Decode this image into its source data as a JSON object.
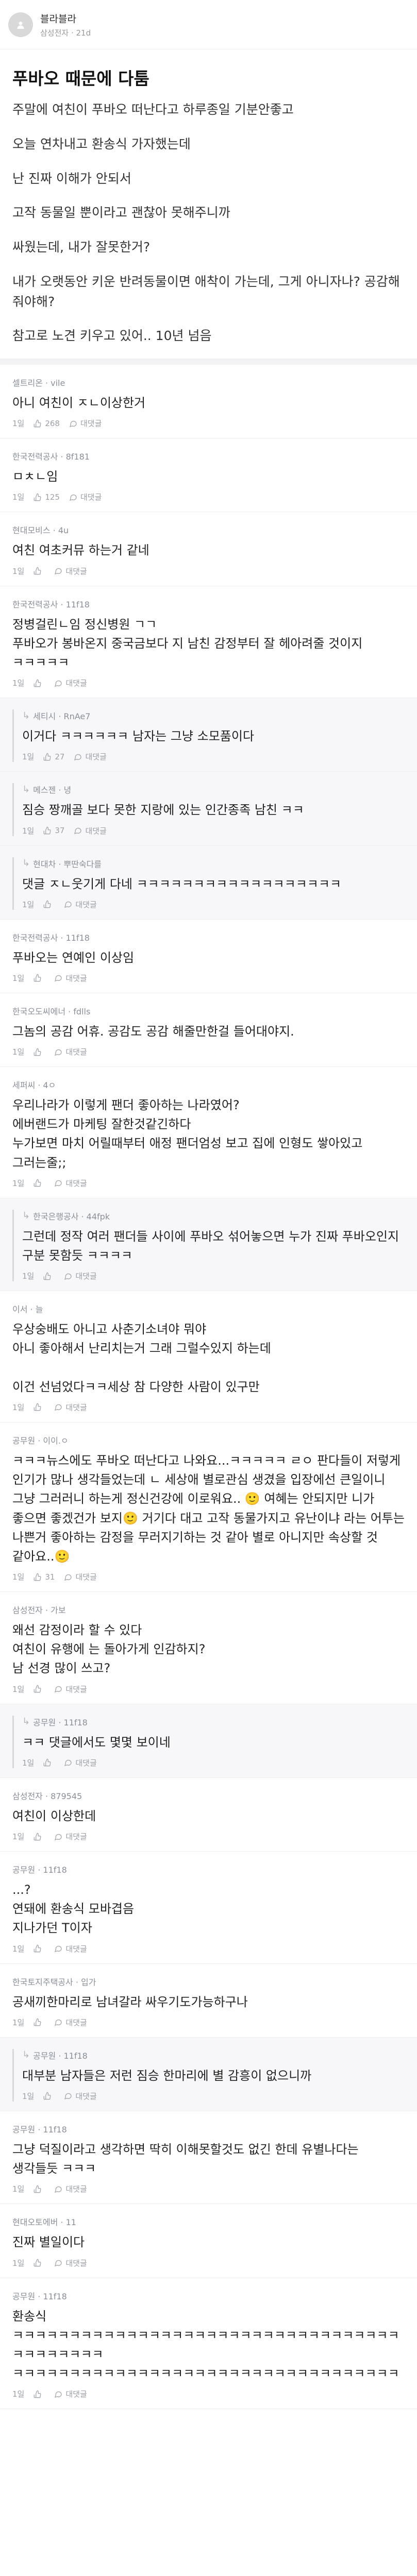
{
  "post": {
    "author_name": "블라블라",
    "author_meta": "삼성전자 · 21d",
    "title": "푸바오 때문에 다툼",
    "body": [
      "주말에 여친이 푸바오 떠난다고 하루종일 기분안좋고",
      "오늘 연차내고 환송식 가자했는데",
      "난 진짜 이해가 안되서",
      "고작 동물일 뿐이라고 괜찮아 못해주니까",
      "싸웠는데, 내가 잘못한거?",
      "내가 오랫동안 키운 반려동물이면 애착이 가는데, 그게 아니자나? 공감해줘야해?",
      "참고로 노견 키우고 있어.. 10년 넘음"
    ]
  },
  "comments": [
    {
      "author": "셀트리온 · vile",
      "text": "아니 여친이 ㅈㄴ이상한거",
      "likes": "268",
      "reply_label": "대댓글",
      "time": "1일",
      "is_reply": false
    },
    {
      "author": "한국전력공사 · 8f181",
      "text": "ㅁㅊㄴ임",
      "likes": "125",
      "reply_label": "대댓글",
      "time": "1일",
      "is_reply": false
    },
    {
      "author": "현대모비스 · 4u",
      "text": "여친 여초커뮤 하는거 같네",
      "likes": "",
      "reply_label": "대댓글",
      "time": "1일",
      "is_reply": false
    },
    {
      "author": "한국전력공사 · 11f18",
      "text": "정병걸린ㄴ임 정신병원 ㄱㄱ\n푸바오가 봉바온지 중국금보다 지 남친 감정부터 잘 헤아려줄 것이지 ㅋㅋㅋㅋㅋ",
      "likes": "",
      "reply_label": "대댓글",
      "time": "1일",
      "is_reply": false
    },
    {
      "author": "세티시 · RnAe7",
      "text": "이거다 ㅋㅋㅋㅋㅋㅋ 남자는 그냥 소모품이다",
      "likes": "27",
      "reply_label": "대댓글",
      "time": "1일",
      "is_reply": true
    },
    {
      "author": "메스젠 · 녕",
      "text": "짐승 짱깨골 보다 못한 지랑에 있는 인간종족 남친 ㅋㅋ",
      "likes": "37",
      "reply_label": "대댓글",
      "time": "1일",
      "is_reply": true
    },
    {
      "author": "현대차 · 뿌딴숙다를",
      "text": "댓글 ㅈㄴ웃기게 다네 ㅋㅋㅋㅋㅋㅋㅋㅋㅋㅋㅋㅋㅋㅋㅋㅋㅋㅋ",
      "likes": "",
      "reply_label": "대댓글",
      "time": "1일",
      "is_reply": true
    },
    {
      "author": "한국전력공사 · 11f18",
      "text": "푸바오는 연예인 이상임",
      "likes": "",
      "reply_label": "대댓글",
      "time": "1일",
      "is_reply": false
    },
    {
      "author": "한국오도씨에너 · fdlls",
      "text": "그놈의 공감 어휴. 공감도 공감 해줄만한걸 들어대야지.",
      "likes": "",
      "reply_label": "대댓글",
      "time": "1일",
      "is_reply": false
    },
    {
      "author": "세퍼씨 · 4ㅇ",
      "text": "우리나라가 이렇게 팬더 좋아하는 나라였어?\n에버랜드가 마케팅 잘한것같긴하다\n누가보면 마치 어릴때부터 애정 팬더엄성 보고 집에 인형도 쌓아있고 그러는줄;;",
      "likes": "",
      "reply_label": "대댓글",
      "time": "1일",
      "is_reply": false
    },
    {
      "author": "한국은행공사 · 44fpk",
      "text": "그런데 정작 여러 팬더들 사이에 푸바오 섞어놓으면 누가 진짜 푸바오인지 구분 못함듯 ㅋㅋㅋㅋ",
      "likes": "",
      "reply_label": "대댓글",
      "time": "1일",
      "is_reply": true
    },
    {
      "author": "이서 · 늘",
      "text": "우상숭배도 아니고 사춘기소녀야 뭐야\n아니 좋아해서 난리치는거 그래 그럴수있지 하는데\n\n이건 선넘었다ㅋㅋ세상 참 다양한 사람이 있구만",
      "likes": "",
      "reply_label": "대댓글",
      "time": "1일",
      "is_reply": false
    },
    {
      "author": "공무원 · 이이.ㅇ",
      "text": "ㅋㅋㅋ뉴스에도 푸바오 떠난다고 나와요...ㅋㅋㅋㅋㅋ ㄹㅇ 판다들이 저렇게 인기가 많나 생각들었는데 ㄴ 세상애 별로관심 생겼을 입장에선 큰일이니 그냥 그러러니 하는게 정신건강에 이로워요.. 🙂 여혜는 안되지만 니가 좋으면 좋겠건가 보지🙂 거기다 대고 고작 동물가지고 유난이냐 라는 어투는 나쁜거 좋아하는 감정을 무러지기하는 것 같아 별로 아니지만 속상할 것 같아요..🙂",
      "likes": "31",
      "reply_label": "대댓글",
      "time": "1일",
      "is_reply": false
    },
    {
      "author": "삼성전자 · 가보",
      "text": "왜선 감정이라 할 수 있다\n여친이 유행에 는 돌아가게 인감하지?\n남 선경 많이 쓰고?",
      "likes": "",
      "reply_label": "대댓글",
      "time": "1일",
      "is_reply": false
    },
    {
      "author": "공무원 · 11f18",
      "text": "ㅋㅋ 댓글에서도 몇몇 보이네",
      "likes": "",
      "reply_label": "대댓글",
      "time": "1일",
      "is_reply": true
    },
    {
      "author": "삼성전자 · 879545",
      "text": "여친이 이상한데",
      "likes": "",
      "reply_label": "대댓글",
      "time": "1일",
      "is_reply": false
    },
    {
      "author": "공무원 · 11f18",
      "text": "...?\n연돼에 환송식 모바겹음\n지나가던 T이자",
      "likes": "",
      "reply_label": "대댓글",
      "time": "1일",
      "is_reply": false
    },
    {
      "author": "한국토지주택공사 · 입가",
      "text": "공새끼한마리로 남녀갈라 싸우기도가능하구나",
      "likes": "",
      "reply_label": "대댓글",
      "time": "1일",
      "is_reply": false
    },
    {
      "author": "공무원 · 11f18",
      "text": "대부분 남자들은 저런 짐승 한마리에 별 감흥이 없으니까",
      "likes": "",
      "reply_label": "대댓글",
      "time": "1일",
      "is_reply": true
    },
    {
      "author": "공무원 · 11f18",
      "text": "그냥 덕질이라고 생각하면 딱히 이해못할것도 없긴 한데 유별나다는 생각들듯 ㅋㅋㅋ",
      "likes": "",
      "reply_label": "대댓글",
      "time": "1일",
      "is_reply": false
    },
    {
      "author": "현대오토에버 · 11",
      "text": "진짜 별일이다",
      "likes": "",
      "reply_label": "대댓글",
      "time": "1일",
      "is_reply": false
    },
    {
      "author": "공무원 · 11f18",
      "text": "환송식 ㅋㅋㅋㅋㅋㅋㅋㅋㅋㅋㅋㅋㅋㅋㅋㅋㅋㅋㅋㅋㅋㅋㅋㅋㅋㅋㅋㅋㅋㅋㅋㅋㅋㅋㅋㅋㅋㅋㅋㅋㅋㅋ\nㅋㅋㅋㅋㅋㅋㅋㅋㅋㅋㅋㅋㅋㅋㅋㅋㅋㅋㅋㅋㅋㅋㅋㅋㅋㅋㅋㅋㅋㅋㅋㅋㅋㅋ",
      "likes": "",
      "reply_label": "대댓글",
      "time": "1일",
      "is_reply": false
    }
  ],
  "icons": {
    "avatar": "person-silhouette-icon",
    "like": "thumb-up-icon",
    "reply": "reply-bubble-icon"
  },
  "colors": {
    "meta_text": "#9b9fa6",
    "reply_background": "#f7f7f9",
    "reply_bar": "#d5d8de"
  }
}
